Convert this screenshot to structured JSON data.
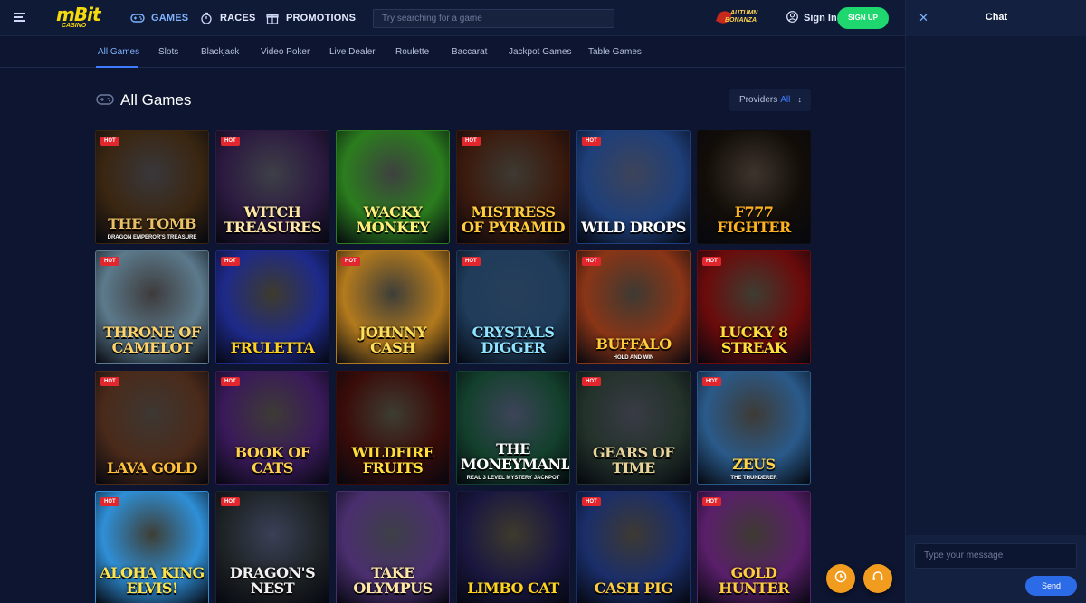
{
  "header": {
    "logo": "mBit",
    "logo_sub": "CASINO",
    "nav_games": "GAMES",
    "nav_races": "RACES",
    "nav_promotions": "PROMOTIONS",
    "search_placeholder": "Try searching for a game",
    "promo_line1": "AUTUMN",
    "promo_line2": "BONANZA",
    "sign_in": "Sign In",
    "sign_up": "SIGN UP"
  },
  "tabs": [
    "All Games",
    "Slots",
    "Blackjack",
    "Video Poker",
    "Live Dealer",
    "Roulette",
    "Baccarat",
    "Jackpot Games",
    "Table Games"
  ],
  "section": {
    "title": "All Games",
    "providers_label": "Providers",
    "providers_value": "All"
  },
  "games": [
    {
      "title": "The Tomb",
      "sub": "DRAGON EMPEROR'S TREASURE",
      "hot": true,
      "bg": "#3a2611",
      "accent": "#e8c067"
    },
    {
      "title": "Witch Treasures",
      "sub": "",
      "hot": true,
      "bg": "#2c1a40",
      "accent": "#ffe8a6"
    },
    {
      "title": "Wacky Monkey",
      "sub": "",
      "hot": false,
      "bg": "#2b7d1e",
      "accent": "#ffef7a"
    },
    {
      "title": "Mistress of Pyramid",
      "sub": "",
      "hot": true,
      "bg": "#3b1a0d",
      "accent": "#ffcd3c"
    },
    {
      "title": "Wild Drops",
      "sub": "",
      "hot": true,
      "bg": "#1e3f7a",
      "accent": "#ffffff"
    },
    {
      "title": "F777 Fighter",
      "sub": "",
      "hot": false,
      "bg": "#120d08",
      "accent": "#ffb21f"
    },
    {
      "title": "Throne of Camelot",
      "sub": "",
      "hot": true,
      "bg": "#5c7a8c",
      "accent": "#ffd36a"
    },
    {
      "title": "Fruletta",
      "sub": "",
      "hot": true,
      "bg": "#1e2a8a",
      "accent": "#ffd21f"
    },
    {
      "title": "Johnny Cash",
      "sub": "",
      "hot": true,
      "bg": "#b37a1d",
      "accent": "#ffe05a"
    },
    {
      "title": "Crystals Digger",
      "sub": "",
      "hot": true,
      "bg": "#1f3c5a",
      "accent": "#8fe3ff"
    },
    {
      "title": "Buffalo",
      "sub": "HOLD AND WIN",
      "hot": true,
      "bg": "#8a3516",
      "accent": "#ffcd3c"
    },
    {
      "title": "Lucky 8 Streak",
      "sub": "",
      "hot": true,
      "bg": "#6b0b0b",
      "accent": "#ffde3b"
    },
    {
      "title": "Lava Gold",
      "sub": "",
      "hot": true,
      "bg": "#4a2a1a",
      "accent": "#ffc13b"
    },
    {
      "title": "Book of Cats",
      "sub": "",
      "hot": true,
      "bg": "#3a1a5a",
      "accent": "#ffd24a"
    },
    {
      "title": "Wildfire Fruits",
      "sub": "",
      "hot": false,
      "bg": "#3a0c09",
      "accent": "#ffde3b"
    },
    {
      "title": "The Moneymania",
      "sub": "REAL 3 LEVEL MYSTERY JACKPOT",
      "hot": false,
      "bg": "#13402c",
      "accent": "#ffffff"
    },
    {
      "title": "Gears of Time",
      "sub": "",
      "hot": true,
      "bg": "#23322a",
      "accent": "#e8d49a"
    },
    {
      "title": "Zeus",
      "sub": "THE THUNDERER",
      "hot": true,
      "bg": "#2a5a8a",
      "accent": "#ffd24a"
    },
    {
      "title": "Aloha King Elvis!",
      "sub": "",
      "hot": true,
      "bg": "#2f8fd6",
      "accent": "#ffe34a"
    },
    {
      "title": "Dragon's Nest",
      "sub": "",
      "hot": true,
      "bg": "#1e2326",
      "accent": "#f0f0f0"
    },
    {
      "title": "Take Olympus",
      "sub": "",
      "hot": false,
      "bg": "#4a2f6e",
      "accent": "#ffe8a6"
    },
    {
      "title": "Limbo Cat",
      "sub": "",
      "hot": false,
      "bg": "#1a1740",
      "accent": "#ffd21f"
    },
    {
      "title": "Cash Pig",
      "sub": "",
      "hot": true,
      "bg": "#1a2e6a",
      "accent": "#ffcd3c"
    },
    {
      "title": "Gold Hunter",
      "sub": "",
      "hot": true,
      "bg": "#5a1f6a",
      "accent": "#ffcd3c"
    }
  ],
  "hot_label": "HOT",
  "chat": {
    "title": "Chat",
    "input_placeholder": "Type your message",
    "send": "Send"
  },
  "colors": {
    "bg": "#0d1530",
    "accent_blue": "#3c7bff",
    "signup_green": "#1fd76f",
    "hot_red": "#e2262d",
    "fab_orange": "#f29c1f"
  }
}
